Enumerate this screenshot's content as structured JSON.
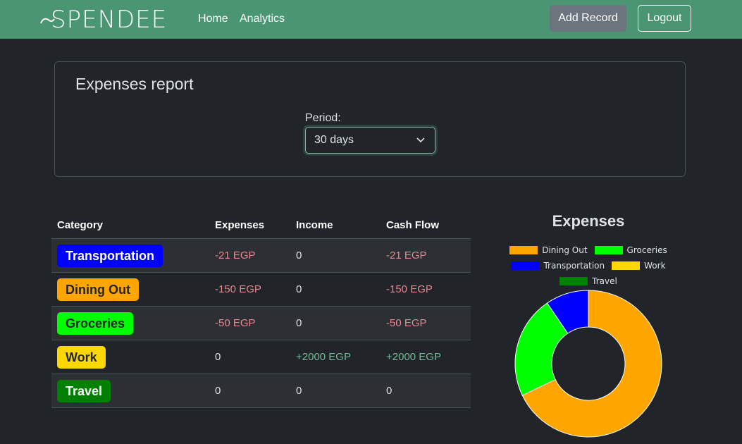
{
  "nav": {
    "brand": "SPENDEE",
    "links": [
      "Home",
      "Analytics"
    ],
    "add_record": "Add Record",
    "logout": "Logout"
  },
  "report": {
    "title": "Expenses report",
    "period_label": "Period:",
    "period_value": "30 days"
  },
  "table": {
    "headers": [
      "Category",
      "Expenses",
      "Income",
      "Cash Flow"
    ],
    "rows": [
      {
        "category": "Transportation",
        "color": "#0000ff",
        "text_color": "#ffffff",
        "expenses": "-21 EGP",
        "income": "0",
        "cash_flow": "-21 EGP"
      },
      {
        "category": "Dining Out",
        "color": "#ffa500",
        "text_color": "#212529",
        "expenses": "-150 EGP",
        "income": "0",
        "cash_flow": "-150 EGP"
      },
      {
        "category": "Groceries",
        "color": "#00ff00",
        "text_color": "#212529",
        "expenses": "-50 EGP",
        "income": "0",
        "cash_flow": "-50 EGP"
      },
      {
        "category": "Work",
        "color": "#ffd700",
        "text_color": "#212529",
        "expenses": "0",
        "income": "+2000 EGP",
        "cash_flow": "+2000 EGP"
      },
      {
        "category": "Travel",
        "color": "#008000",
        "text_color": "#ffffff",
        "expenses": "0",
        "income": "0",
        "cash_flow": "0"
      }
    ]
  },
  "chart_data": {
    "type": "pie",
    "title": "Expenses",
    "legend_position": "top",
    "categories": [
      "Dining Out",
      "Groceries",
      "Transportation",
      "Work",
      "Travel"
    ],
    "values": [
      150,
      50,
      21,
      0,
      0
    ],
    "colors": [
      "#ffa500",
      "#00ff00",
      "#0000ff",
      "#ffd700",
      "#008000"
    ]
  }
}
